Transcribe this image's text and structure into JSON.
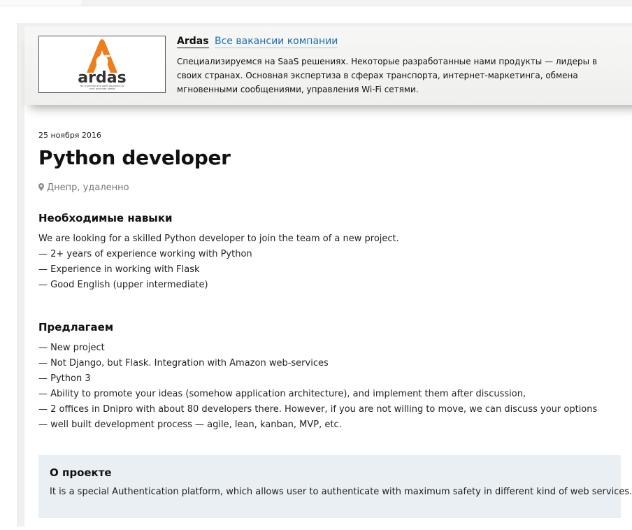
{
  "company": {
    "name": "Ardas",
    "link_label": "Все вакансии компании",
    "description": "Специализируемся на SaaS решениях. Некоторые разработанные нами продукты — лидеры в своих странах. Основная экспертиза в сферах транспорта, интернет-маркетинга, обмена мгновенными сообщениями, управления Wi-Fi сетями.",
    "logo_text": "ardas",
    "logo_tagline_1": "for a precise and agile approach to",
    "logo_tagline_2": "your business needs",
    "logo_color": "#f07d1b"
  },
  "vacancy": {
    "date": "25 ноября 2016",
    "title": "Python developer",
    "location": "Днепр, удаленно"
  },
  "skills": {
    "heading": "Необходимые навыки",
    "lines": [
      "We are looking for a skilled Python developer to join the team of a new project.",
      "— 2+ years of experience working with Python",
      "— Experience in working with Flask",
      "— Good English (upper intermediate)"
    ]
  },
  "offer": {
    "heading": "Предлагаем",
    "lines": [
      "— New project",
      "— Not Django, but Flask. Integration with Amazon web-services",
      "— Python 3",
      "— Ability to promote your ideas (somehow application architecture), and implement them after discussion,",
      "— 2 offices in Dnipro with about 80 developers there. However, if you are not willing to move, we can discuss your options",
      "— well built development process — agile, lean, kanban, MVP, etc."
    ]
  },
  "project": {
    "heading": "О проекте",
    "text": "It is a special Authentication platform, which allows user to authenticate with maximum safety in different kind of web services."
  },
  "icons": {
    "location": "map-pin-icon"
  },
  "colors": {
    "link": "#1a6fb5",
    "project_bg": "#e9eff3"
  }
}
